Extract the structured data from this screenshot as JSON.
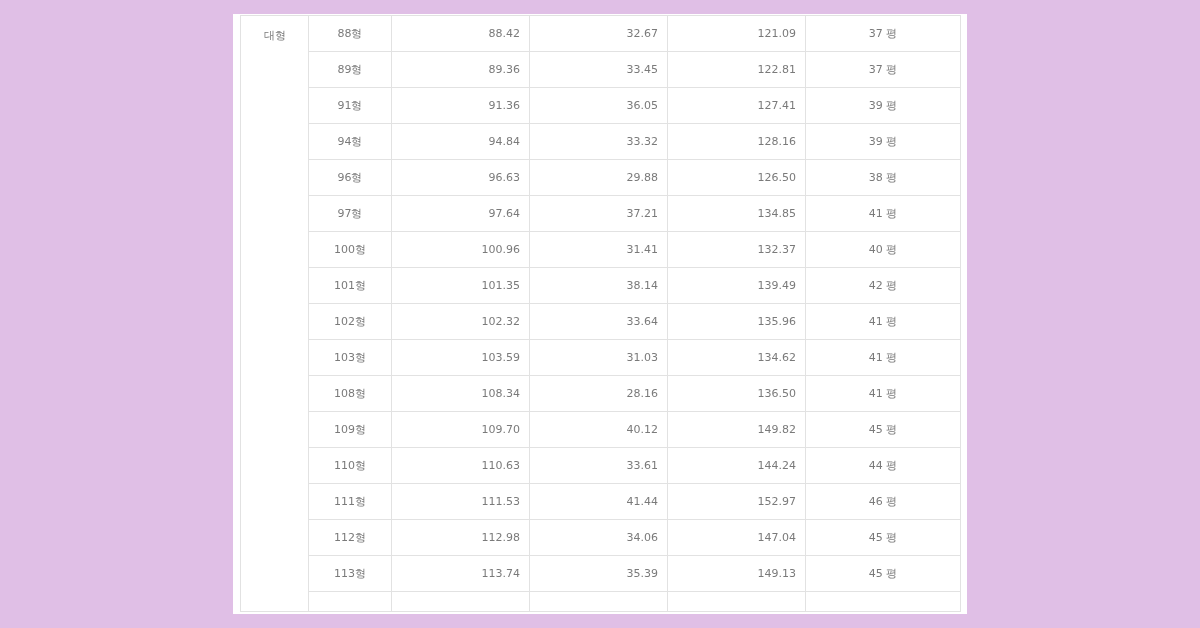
{
  "table": {
    "group": "대형",
    "rows": [
      {
        "cells": [
          "88형",
          "88.42",
          "32.67",
          "121.09",
          "37 평"
        ]
      },
      {
        "cells": [
          "89형",
          "89.36",
          "33.45",
          "122.81",
          "37 평"
        ]
      },
      {
        "cells": [
          "91형",
          "91.36",
          "36.05",
          "127.41",
          "39 평"
        ]
      },
      {
        "cells": [
          "94형",
          "94.84",
          "33.32",
          "128.16",
          "39 평"
        ]
      },
      {
        "cells": [
          "96형",
          "96.63",
          "29.88",
          "126.50",
          "38 평"
        ]
      },
      {
        "cells": [
          "97형",
          "97.64",
          "37.21",
          "134.85",
          "41 평"
        ]
      },
      {
        "cells": [
          "100형",
          "100.96",
          "31.41",
          "132.37",
          "40 평"
        ]
      },
      {
        "cells": [
          "101형",
          "101.35",
          "38.14",
          "139.49",
          "42 평"
        ]
      },
      {
        "cells": [
          "102형",
          "102.32",
          "33.64",
          "135.96",
          "41 평"
        ]
      },
      {
        "cells": [
          "103형",
          "103.59",
          "31.03",
          "134.62",
          "41 평"
        ]
      },
      {
        "cells": [
          "108형",
          "108.34",
          "28.16",
          "136.50",
          "41 평"
        ]
      },
      {
        "cells": [
          "109형",
          "109.70",
          "40.12",
          "149.82",
          "45 평"
        ]
      },
      {
        "cells": [
          "110형",
          "110.63",
          "33.61",
          "144.24",
          "44 평"
        ]
      },
      {
        "cells": [
          "111형",
          "111.53",
          "41.44",
          "152.97",
          "46 평"
        ]
      },
      {
        "cells": [
          "112형",
          "112.98",
          "34.06",
          "147.04",
          "45 평"
        ]
      },
      {
        "cells": [
          "113형",
          "113.74",
          "35.39",
          "149.13",
          "45 평"
        ]
      }
    ]
  }
}
